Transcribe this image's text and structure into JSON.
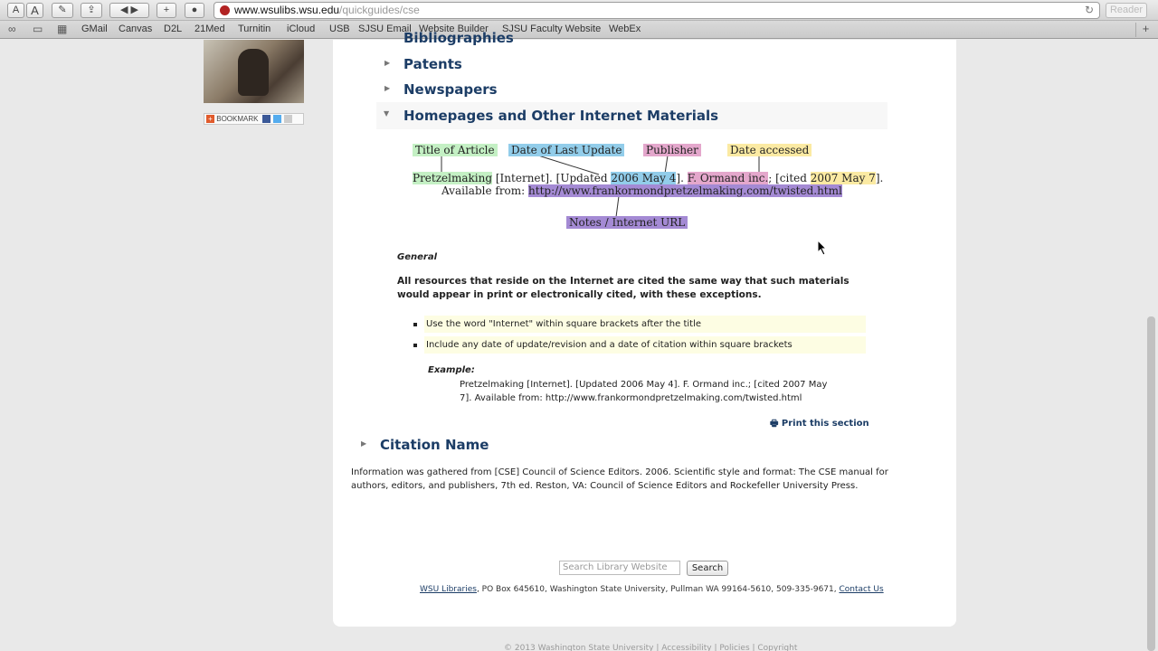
{
  "browser": {
    "url_host": "www.wsulibs.wsu.edu",
    "url_path": "/quickguides/cse",
    "reader_label": "Reader",
    "bookmarks": [
      "GMail",
      "Canvas",
      "D2L",
      "21Med",
      "Turnitin",
      "iCloud",
      "USB",
      "SJSU Email",
      "Website Builder",
      "SJSU Faculty Website",
      "WebEx"
    ]
  },
  "sidebar": {
    "bookmark_label": "BOOKMARK"
  },
  "sections": {
    "bibliographies": "Bibliographies",
    "patents": "Patents",
    "newspapers": "Newspapers",
    "homepages": "Homepages and Other Internet Materials",
    "citation_name": "Citation Name"
  },
  "diagram": {
    "labels": {
      "title": "Title of Article",
      "date_update": "Date of Last Update",
      "publisher": "Publisher",
      "date_accessed": "Date accessed",
      "notes_url": "Notes / Internet URL"
    },
    "citation": {
      "title": "Pretzelmaking",
      "internet": " [Internet]. [Updated ",
      "update_date": "2006 May 4",
      "sep1": "]. ",
      "publisher": "F. Ormand inc.",
      "cited": "; [cited ",
      "accessed": "2007 May 7",
      "sep2": "].",
      "available": "Available from: ",
      "url": "http://www.frankormondpretzelmaking.com/twisted.html"
    }
  },
  "content": {
    "general_heading": "General",
    "intro": "All resources that reside on the Internet are cited the same way that such materials would appear in print or electronically cited, with these exceptions.",
    "bullets": [
      "Use the word \"Internet\" within square brackets after the title",
      "Include any date of update/revision and a date of citation within square brackets"
    ],
    "example_label": "Example:",
    "example_text": "Pretzelmaking [Internet]. [Updated 2006 May 4]. F. Ormand inc.; [cited 2007 May 7]. Available from: http://www.frankormondpretzelmaking.com/twisted.html",
    "print_label": "Print this section",
    "info": "Information was gathered from [CSE] Council of Science Editors. 2006. Scientific style and format: The CSE manual for authors, editors, and publishers, 7th ed. Reston, VA: Council of Science Editors and Rockefeller University Press."
  },
  "footer": {
    "search_placeholder": "Search Library Website",
    "search_button": "Search",
    "libraries_link": "WSU Libraries",
    "address": ", PO Box 645610, Washington State University, Pullman WA 99164-5610, 509-335-9671, ",
    "contact_link": "Contact Us",
    "copyright": "© 2013 Washington State University | Accessibility | Policies | Copyright"
  }
}
